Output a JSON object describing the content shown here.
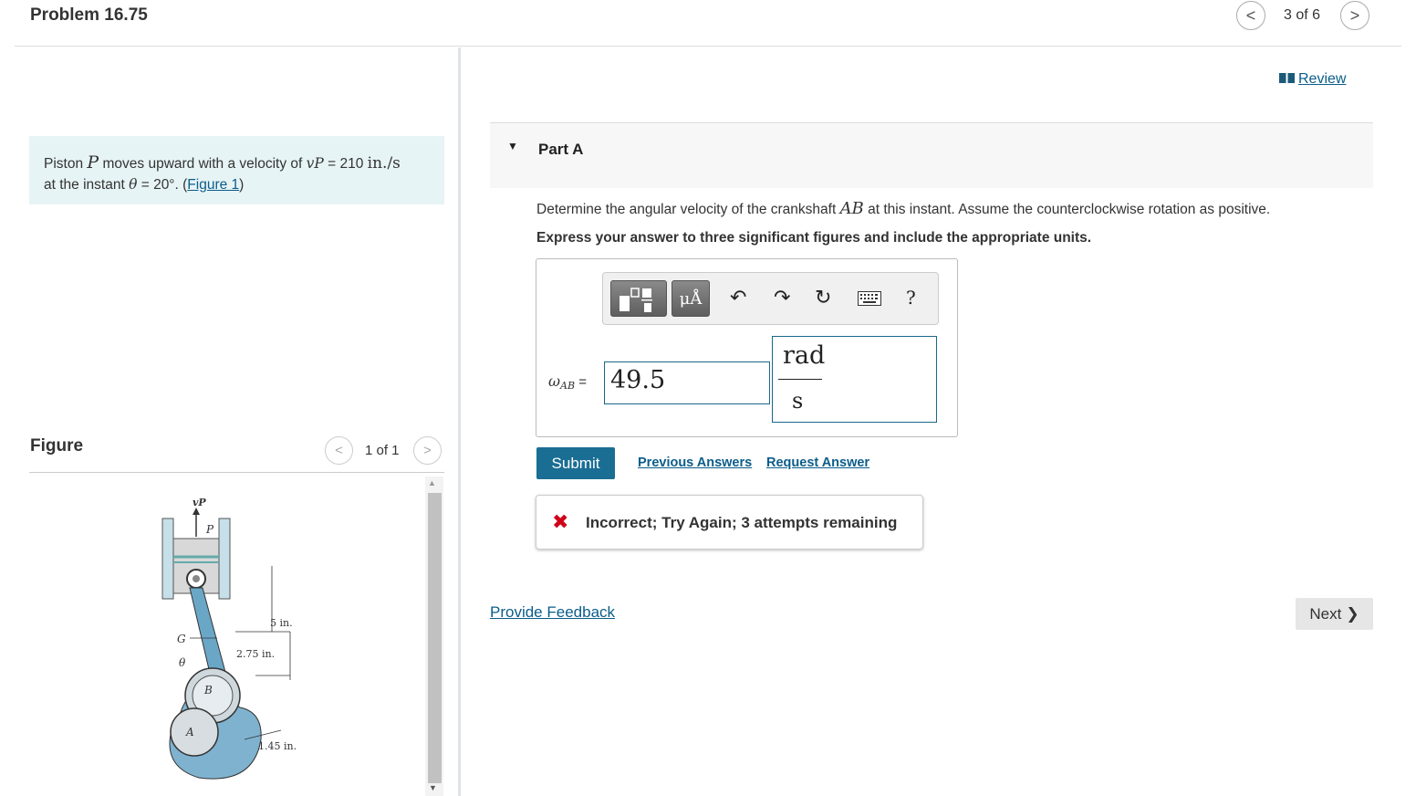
{
  "header": {
    "title": "Problem 16.75",
    "pager": "3 of 6",
    "prev_glyph": "<",
    "next_glyph": ">"
  },
  "problem": {
    "text_1": "Piston ",
    "text_p": "P",
    "text_2": " moves upward with a velocity of ",
    "text_vp": "vP",
    "text_3": " = 210 ",
    "text_unit": "in./s",
    "text_4": "at the instant ",
    "text_theta": "θ",
    "text_5": " = 20°. (",
    "figure_link": "Figure 1",
    "text_6": ")"
  },
  "figure": {
    "heading": "Figure",
    "pager": "1 of 1",
    "labels": {
      "vp": "vP",
      "p": "P",
      "g": "G",
      "theta": "θ",
      "b": "B",
      "a": "A",
      "dim_5": "5 in.",
      "dim_275": "2.75 in.",
      "dim_145": "1.45 in."
    }
  },
  "review": {
    "label": "Review"
  },
  "part": {
    "caret": "▼",
    "label": "Part A",
    "question_1": "Determine the angular velocity of the crankshaft ",
    "question_ab": "AB",
    "question_2": " at this instant. Assume the counterclockwise rotation as positive.",
    "instruction": "Express your answer to three significant figures and include the appropriate units."
  },
  "answer": {
    "omega": "ω",
    "sub": "AB",
    "equals": " =",
    "value": "49.5",
    "unit_numerator": "rad",
    "unit_denominator": "s"
  },
  "toolbar": {
    "units_label": "μÅ",
    "undo": "↶",
    "redo": "↷",
    "reset": "↻",
    "help": "?"
  },
  "actions": {
    "submit": "Submit",
    "previous_answers": "Previous Answers",
    "request_answer": "Request Answer"
  },
  "feedback": {
    "icon": "✖",
    "message": "Incorrect; Try Again; 3 attempts remaining"
  },
  "footer": {
    "provide_feedback": "Provide Feedback",
    "next": "Next"
  },
  "colors": {
    "accent": "#1a6e94",
    "error": "#d0021b",
    "problem_bg": "#e7f4f6"
  }
}
